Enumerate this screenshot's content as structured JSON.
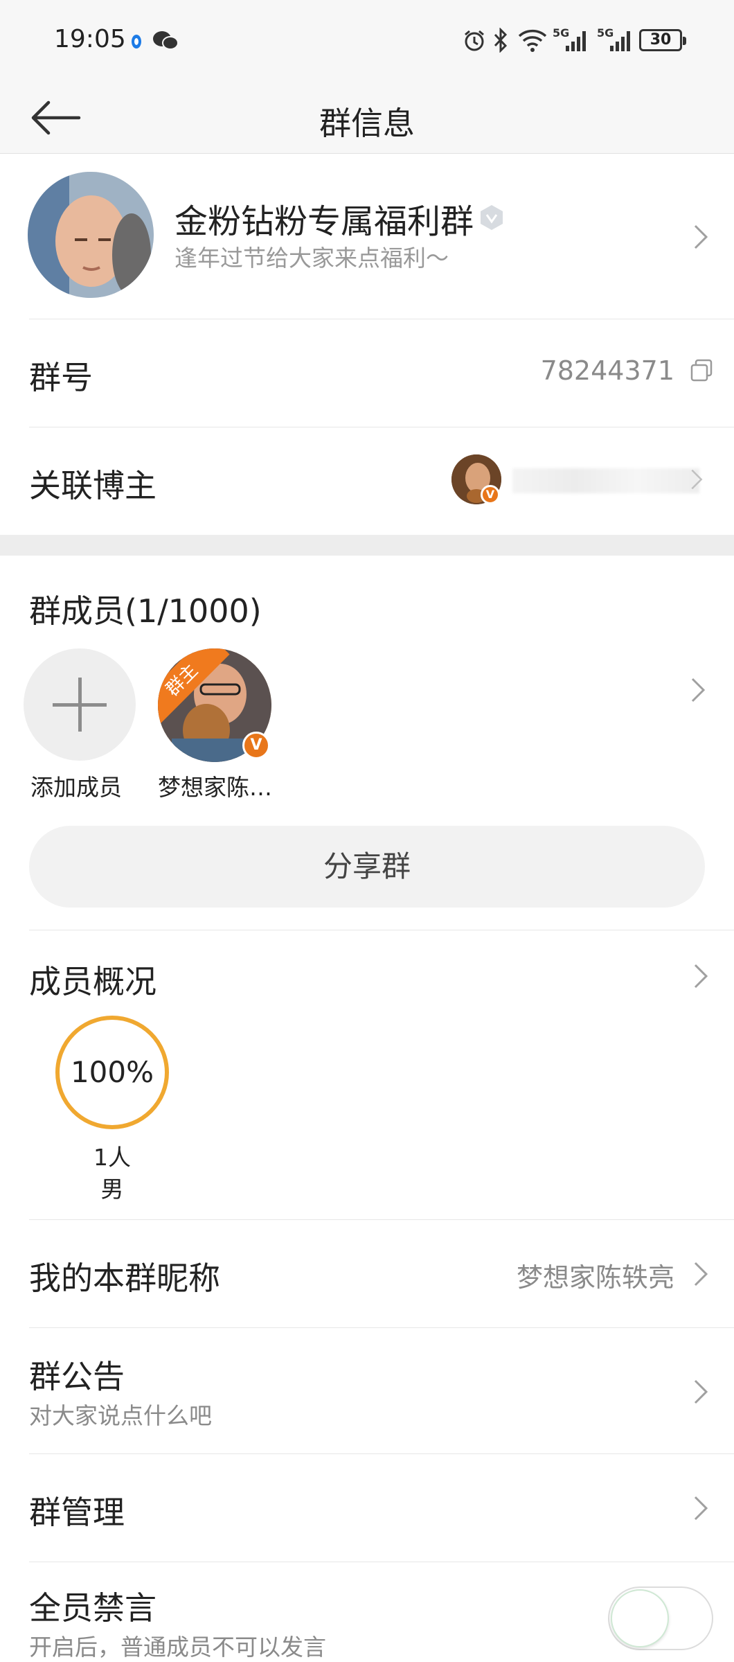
{
  "status_bar": {
    "time": "19:05",
    "network_1": "5G",
    "network_2": "5G",
    "battery": "30"
  },
  "header": {
    "title": "群信息"
  },
  "group": {
    "name": "金粉钻粉专属福利群",
    "description": "逢年过节给大家来点福利～"
  },
  "group_number": {
    "label": "群号",
    "value": "78244371"
  },
  "linked_blogger": {
    "label": "关联博主"
  },
  "members": {
    "title": "群成员(1/1000)",
    "add_label": "添加成员",
    "owner_badge": "群主",
    "list": [
      {
        "name": "梦想家陈…"
      }
    ]
  },
  "share_button": "分享群",
  "overview": {
    "title": "成员概况",
    "percent": "100%",
    "count": "1人",
    "gender": "男"
  },
  "nickname": {
    "label": "我的本群昵称",
    "value": "梦想家陈轶亮"
  },
  "announcement": {
    "label": "群公告",
    "hint": "对大家说点什么吧"
  },
  "management": {
    "label": "群管理"
  },
  "mute_all": {
    "label": "全员禁言",
    "hint": "开启后，普通成员不可以发言",
    "enabled": false
  },
  "colors": {
    "accent_orange": "#f07a1e",
    "ring": "#f0a830",
    "text_gray": "#8a8a8a"
  }
}
